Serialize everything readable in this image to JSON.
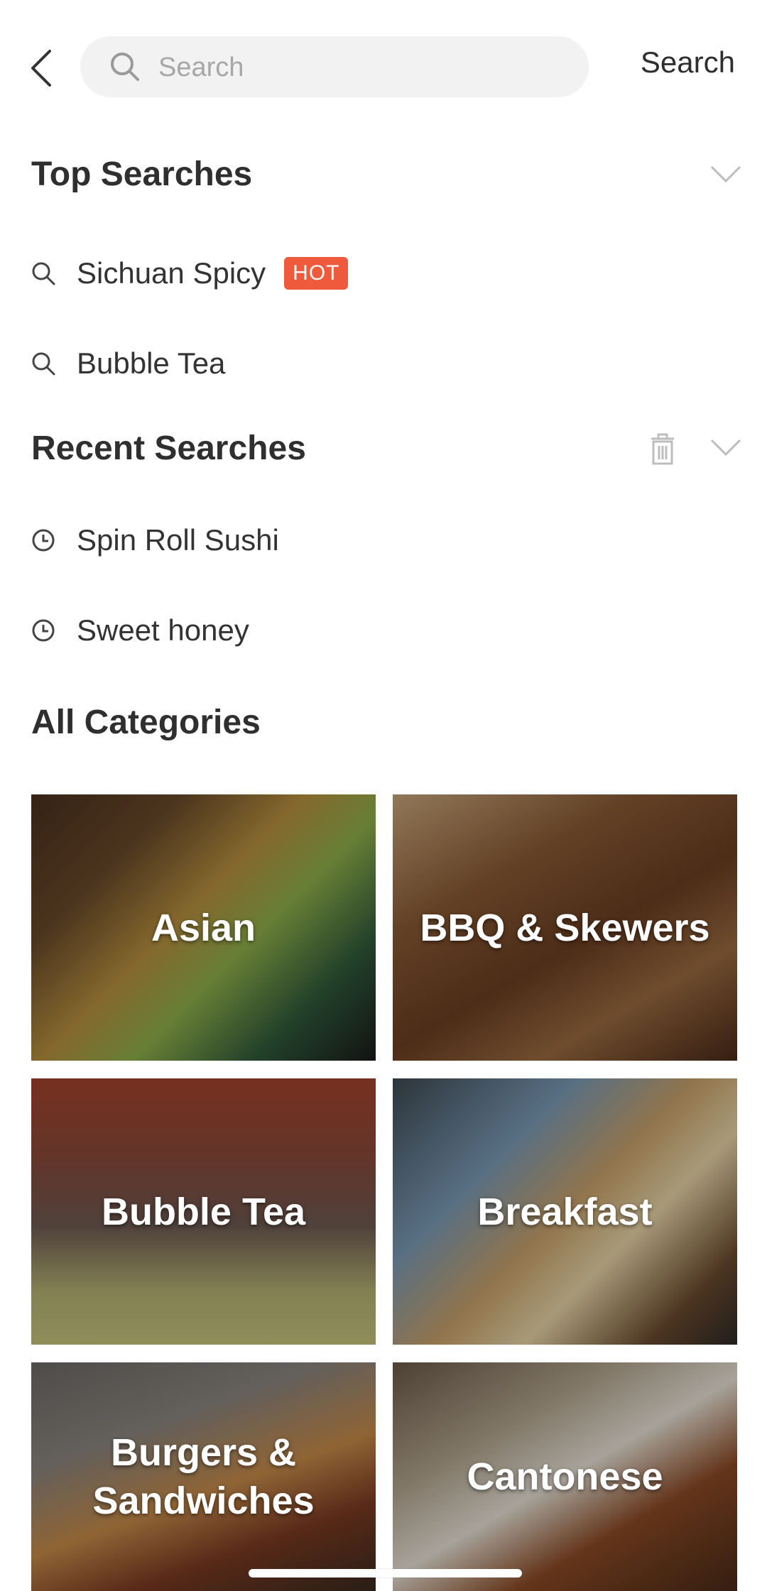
{
  "header": {
    "search_placeholder": "Search",
    "search_button": "Search"
  },
  "top_searches": {
    "title": "Top Searches",
    "items": [
      {
        "label": "Sichuan Spicy",
        "badge": "HOT"
      },
      {
        "label": "Bubble Tea"
      }
    ]
  },
  "recent_searches": {
    "title": "Recent Searches",
    "items": [
      {
        "label": "Spin Roll Sushi"
      },
      {
        "label": "Sweet honey"
      }
    ]
  },
  "categories": {
    "title": "All Categories",
    "items": [
      {
        "label": "Asian"
      },
      {
        "label": "BBQ & Skewers"
      },
      {
        "label": "Bubble Tea"
      },
      {
        "label": "Breakfast"
      },
      {
        "label": "Burgers & Sandwiches"
      },
      {
        "label": "Cantonese"
      }
    ]
  },
  "colors": {
    "hot_badge": "#ef5a3c",
    "search_bg": "#f2f2f2"
  },
  "icons": {
    "back": "chevron-left-icon",
    "search": "search-icon",
    "collapse": "chevron-down-icon",
    "delete": "trash-icon",
    "history": "clock-icon"
  }
}
